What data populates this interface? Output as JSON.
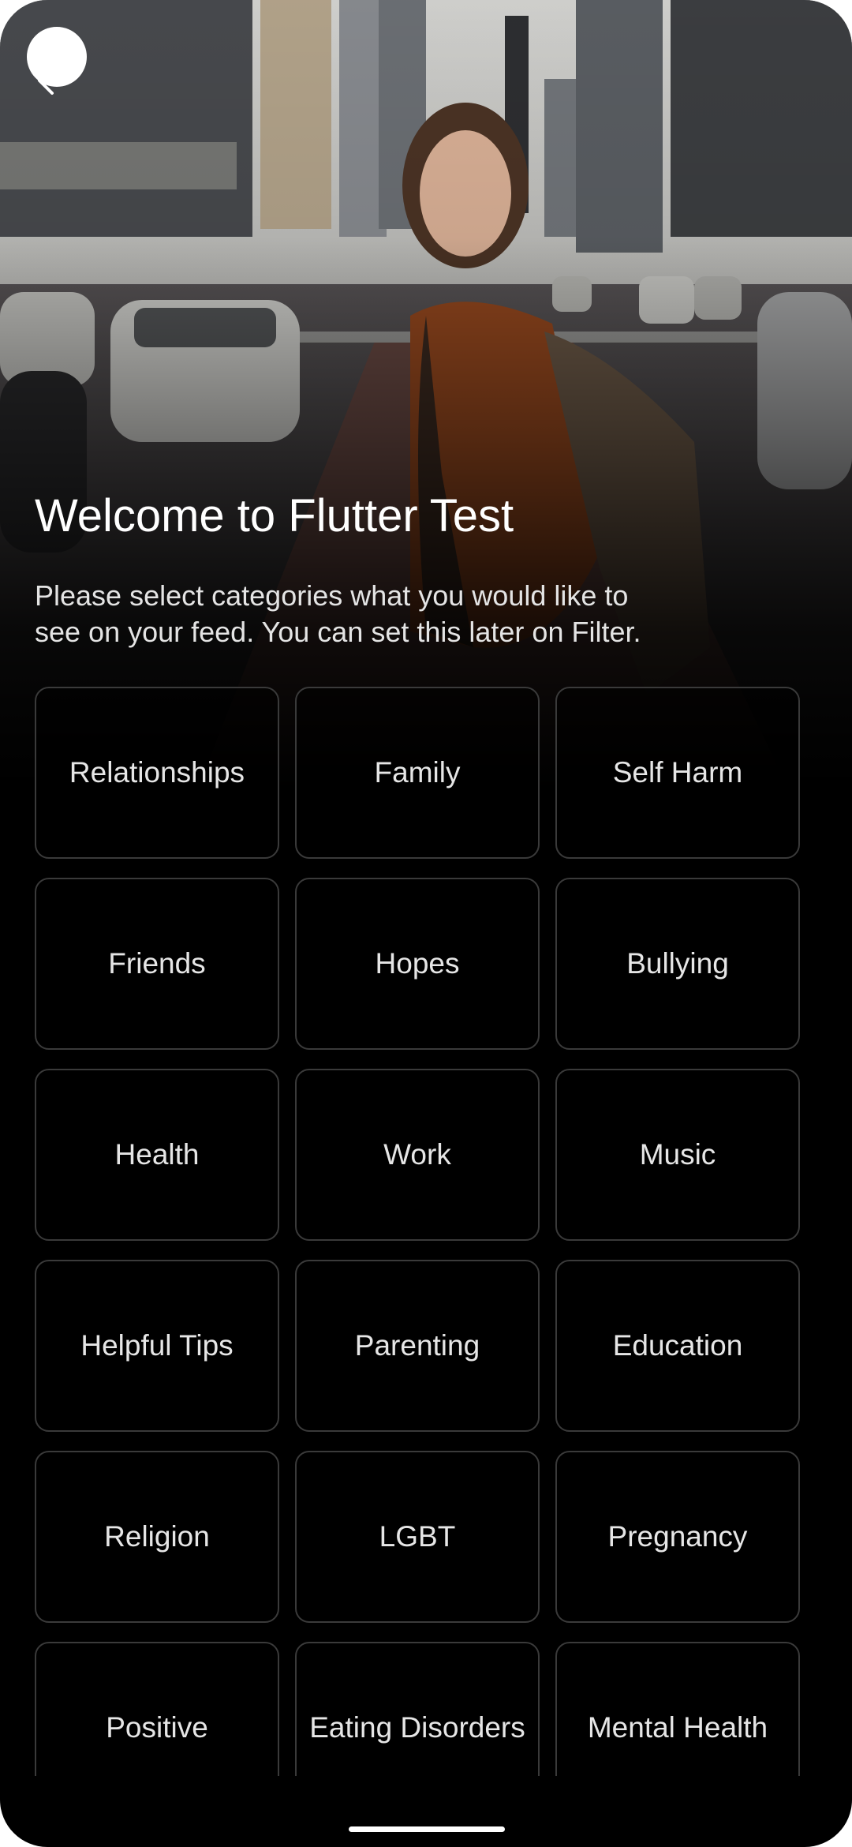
{
  "header": {
    "title": "Welcome to Flutter Test",
    "subtitle": "Please select categories what you would like to\n see on your feed. You can set this later on Filter."
  },
  "icons": {
    "back": "chevron-left-icon"
  },
  "categories": [
    "Relationships",
    "Family",
    "Self Harm",
    "Friends",
    "Hopes",
    "Bullying",
    "Health",
    "Work",
    "Music",
    "Helpful Tips",
    "Parenting",
    "Education",
    "Religion",
    "LGBT",
    "Pregnancy",
    "Positive",
    "Eating Disorders",
    "Mental Health"
  ],
  "colors": {
    "background": "#000000",
    "tile_border": "#3a3a3a",
    "text": "#e6e6e6"
  }
}
